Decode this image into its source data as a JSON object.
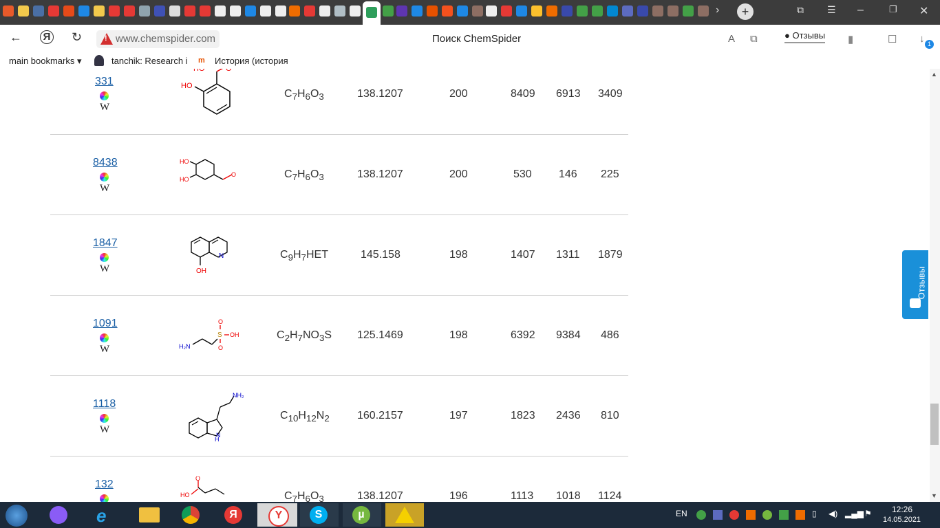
{
  "browser": {
    "url": "www.chemspider.com",
    "page_title": "Поиск ChemSpider",
    "feedback_label": "Отзывы",
    "download_badge": "1"
  },
  "bookmarks": [
    {
      "label": "main bookmarks ▾"
    },
    {
      "label": "tanchik: Research i"
    },
    {
      "label": "История (история"
    }
  ],
  "rows": [
    {
      "id": "331",
      "formula_html": "C<sub>7</sub>H<sub>6</sub>O<sub>3</sub>",
      "mass": "138.1207",
      "c1": "200",
      "c2": "8409",
      "c3": "6913",
      "c4": "3409"
    },
    {
      "id": "8438",
      "formula_html": "C<sub>7</sub>H<sub>6</sub>O<sub>3</sub>",
      "mass": "138.1207",
      "c1": "200",
      "c2": "530",
      "c3": "146",
      "c4": "225"
    },
    {
      "id": "1847",
      "formula_html": "C<sub>9</sub>H<sub>7</sub>HET",
      "mass": "145.158",
      "c1": "198",
      "c2": "1407",
      "c3": "1311",
      "c4": "1879"
    },
    {
      "id": "1091",
      "formula_html": "C<sub>2</sub>H<sub>7</sub>NO<sub>3</sub>S",
      "mass": "125.1469",
      "c1": "198",
      "c2": "6392",
      "c3": "9384",
      "c4": "486"
    },
    {
      "id": "1118",
      "formula_html": "C<sub>10</sub>H<sub>12</sub>N<sub>2</sub>",
      "mass": "160.2157",
      "c1": "197",
      "c2": "1823",
      "c3": "2436",
      "c4": "810"
    },
    {
      "id": "132",
      "formula_html": "C<sub>7</sub>H<sub>6</sub>O<sub>3</sub>",
      "mass": "138.1207",
      "c1": "196",
      "c2": "1113",
      "c3": "1018",
      "c4": "1124"
    }
  ],
  "wiki_glyph": "W",
  "side_tab": {
    "label": "Отзывы"
  },
  "taskbar": {
    "lang": "EN",
    "time": "12:26",
    "date": "14.05.2021"
  },
  "colors": {
    "link": "#1a5fa5",
    "tabstrip": "#3c3c3c",
    "side_tab": "#1a90d9",
    "taskbar": "#1c2a3a",
    "warning": "#d32f2f"
  }
}
